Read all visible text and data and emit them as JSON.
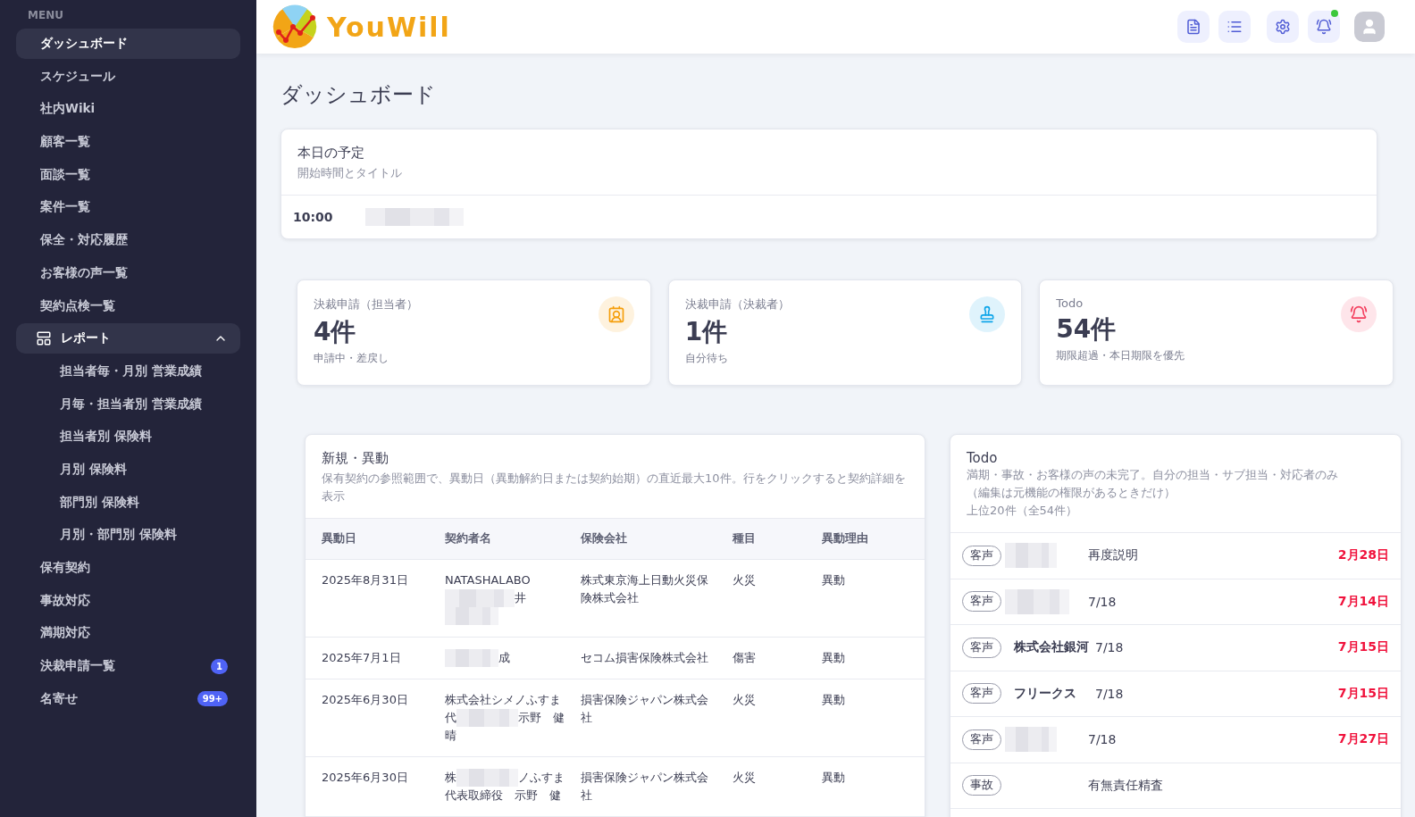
{
  "sidebar": {
    "heading": "MENU",
    "items": [
      {
        "kind": "link",
        "label": "ダッシュボード",
        "selected": true
      },
      {
        "kind": "link",
        "label": "スケジュール",
        "selected": false
      },
      {
        "kind": "link",
        "label": "社内Wiki",
        "selected": false
      },
      {
        "kind": "link",
        "label": "顧客一覧",
        "selected": false
      },
      {
        "kind": "link",
        "label": "面談一覧",
        "selected": false
      },
      {
        "kind": "link",
        "label": "案件一覧",
        "selected": false
      },
      {
        "kind": "link",
        "label": "保全・対応履歴",
        "selected": false
      },
      {
        "kind": "link",
        "label": "お客様の声一覧",
        "selected": false
      },
      {
        "kind": "link",
        "label": "契約点検一覧",
        "selected": false
      },
      {
        "kind": "group",
        "label": "レポート",
        "expanded": true,
        "children": [
          {
            "label": "担当者毎・月別 営業成績",
            "selected": false
          },
          {
            "label": "月毎・担当者別 営業成績",
            "selected": false
          },
          {
            "label": "担当者別 保険料",
            "selected": false
          },
          {
            "label": "月別 保険料",
            "selected": false
          },
          {
            "label": "部門別 保険料",
            "selected": false
          },
          {
            "label": "月別・部門別 保険料",
            "selected": false
          }
        ]
      },
      {
        "kind": "link",
        "label": "保有契約",
        "selected": false
      },
      {
        "kind": "link",
        "label": "事故対応",
        "selected": false
      },
      {
        "kind": "link",
        "label": "満期対応",
        "selected": false
      },
      {
        "kind": "link",
        "label": "決裁申請一覧",
        "selected": false,
        "badge": "1"
      },
      {
        "kind": "link",
        "label": "名寄せ",
        "selected": false,
        "badge": "99+"
      }
    ]
  },
  "header": {
    "logo": "YouWill",
    "notification_dot": true
  },
  "page_title": "ダッシュボード",
  "schedule": {
    "title": "本日の予定",
    "subtitle": "開始時間とタイトル",
    "rows": [
      {
        "time": "10:00",
        "title": {
          "kind": "redacted"
        }
      }
    ]
  },
  "stats": [
    {
      "kind": "applicant",
      "label": "決裁申請（担当者）",
      "value": "4件",
      "note": "申請中・差戻し",
      "color": "#f59e0b"
    },
    {
      "kind": "approver",
      "label": "決裁申請（決裁者）",
      "value": "1件",
      "note": "自分待ち",
      "color": "#0ea5e9"
    },
    {
      "kind": "todo",
      "label": "Todo",
      "value": "54件",
      "note": "期限超過・本日期限を優先",
      "color": "#f43f5e"
    }
  ],
  "changes": {
    "title": "新規・異動",
    "description": "保有契約の参照範囲で、異動日（異動解約日または契約始期）の直近最大10件。行をクリックすると契約詳細を表示",
    "columns": [
      "異動日",
      "契約者名",
      "保険会社",
      "種目",
      "異動理由"
    ],
    "rows": [
      {
        "date": "2025年8月31日",
        "contractor": [
          [
            {
              "kind": "text",
              "text": "NATASHALABO"
            }
          ],
          [
            {
              "kind": "redacted"
            },
            {
              "kind": "text",
              "text": "井"
            }
          ],
          [
            {
              "kind": "redacted"
            }
          ]
        ],
        "company": "株式東京海上日動火災保険株式会社",
        "category": "火災",
        "reason": "異動"
      },
      {
        "date": "2025年7月1日",
        "contractor": [
          [
            {
              "kind": "redacted"
            },
            {
              "kind": "text",
              "text": "成"
            }
          ]
        ],
        "company": "セコム損害保険株式会社",
        "category": "傷害",
        "reason": "異動"
      },
      {
        "date": "2025年6月30日",
        "contractor": [
          [
            {
              "kind": "text",
              "text": "株式会社シメノふすま"
            }
          ],
          [
            {
              "kind": "text",
              "text": "代"
            },
            {
              "kind": "redacted"
            },
            {
              "kind": "text",
              "text": "示野　健"
            }
          ],
          [
            {
              "kind": "text",
              "text": "晴"
            }
          ]
        ],
        "company": "損害保険ジャパン株式会社",
        "category": "火災",
        "reason": "異動"
      },
      {
        "date": "2025年6月30日",
        "contractor": [
          [
            {
              "kind": "text",
              "text": "株"
            },
            {
              "kind": "redacted"
            },
            {
              "kind": "text",
              "text": "ノふすま"
            }
          ],
          [
            {
              "kind": "text",
              "text": "代表取締役　示野　健"
            }
          ]
        ],
        "company": "損害保険ジャパン株式会社",
        "category": "火災",
        "reason": "異動"
      }
    ]
  },
  "todo": {
    "title": "Todo",
    "description": [
      "満期・事故・お客様の声の未完了。自分の担当・サブ担当・対応者のみ",
      "（編集は元機能の権限があるときだけ）",
      "上位20件（全54件）"
    ],
    "rows": [
      {
        "tag": "客声",
        "name": {
          "kind": "redacted"
        },
        "note": "再度説明",
        "due": "2月28日"
      },
      {
        "tag": "客声",
        "name": {
          "kind": "redacted"
        },
        "note": "7/18",
        "due": "7月14日"
      },
      {
        "tag": "客声",
        "name": {
          "kind": "text",
          "text": "株式会社銀河"
        },
        "note": "7/18",
        "due": "7月15日"
      },
      {
        "tag": "客声",
        "name": {
          "kind": "text",
          "text": "フリークス"
        },
        "note": "7/18",
        "due": "7月15日"
      },
      {
        "tag": "客声",
        "name": {
          "kind": "redacted"
        },
        "note": "7/18",
        "due": "7月27日"
      },
      {
        "tag": "事故",
        "note": "有無責任精査"
      }
    ]
  }
}
